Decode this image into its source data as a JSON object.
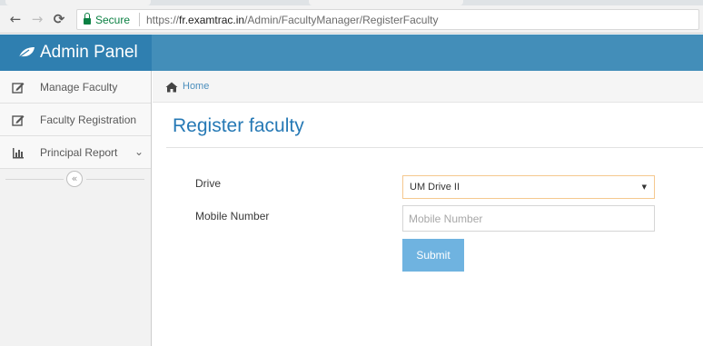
{
  "browser": {
    "nav": {
      "back_icon": "←",
      "forward_icon": "→",
      "reload_icon": "⟳"
    },
    "security": {
      "label": "Secure"
    },
    "url": {
      "scheme": "https://",
      "host": "fr.examtrac.in",
      "path": "/Admin/FacultyManager/RegisterFaculty"
    }
  },
  "header": {
    "brand_title": "Admin Panel",
    "brand_icon": "leaf-icon",
    "color": "#438eb9"
  },
  "sidebar": {
    "items": [
      {
        "label": "Manage Faculty",
        "icon": "edit-icon"
      },
      {
        "label": "Faculty Registration",
        "icon": "edit-icon"
      },
      {
        "label": "Principal Report",
        "icon": "bar-chart-icon",
        "has_submenu": true
      }
    ],
    "collapse_icon": "«"
  },
  "breadcrumb": {
    "home_label": "Home",
    "home_icon": "home-icon"
  },
  "main": {
    "title": "Register faculty",
    "form": {
      "drive_label": "Drive",
      "drive_value": "UM Drive II",
      "mobile_label": "Mobile Number",
      "mobile_placeholder": "Mobile Number",
      "mobile_value": "",
      "submit_label": "Submit"
    }
  },
  "colors": {
    "accent": "#438eb9",
    "title": "#2679b5",
    "button": "#6fb3e0",
    "secure": "#0b8043"
  }
}
